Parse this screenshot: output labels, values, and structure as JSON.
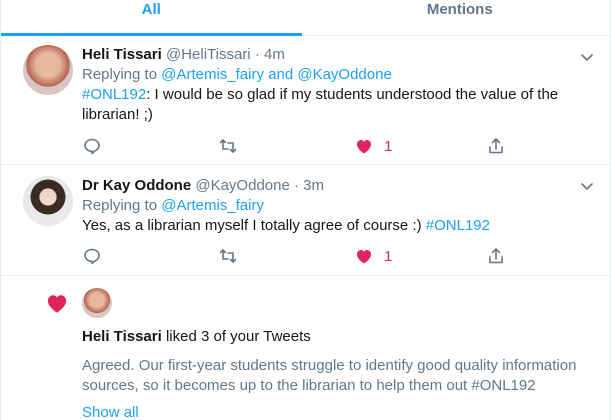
{
  "tabs": [
    {
      "label": "All",
      "active": true
    },
    {
      "label": "Mentions",
      "active": false
    }
  ],
  "tweets": [
    {
      "name": "Heli Tissari",
      "handle": "@HeliTissari",
      "time": "· 4m",
      "replying_prefix": "Replying to ",
      "reply_user_1": "@Artemis_fairy",
      "reply_and": " and ",
      "reply_user_2": "@KayOddone",
      "hashtag": "#ONL192",
      "text": ": I would be so glad if my students understood the value of the librarian! ;)",
      "likes": "1"
    },
    {
      "name": "Dr Kay Oddone",
      "handle": "@KayOddone",
      "time": "· 3m",
      "replying_prefix": "Replying to ",
      "reply_user_1": "@Artemis_fairy",
      "text": "Yes, as a librarian myself I totally agree of course :) ",
      "hashtag": "#ONL192",
      "likes": "1"
    }
  ],
  "notification": {
    "name": "Heli Tissari",
    "action": " liked 3 of your Tweets",
    "quote": "Agreed. Our first-year students struggle to identify good quality information sources, so it becomes up to the librarian to help them out #ONL192",
    "show_all": "Show all"
  },
  "colors": {
    "accent": "#1da1f2",
    "like": "#e0245e",
    "muted": "#657786",
    "text": "#14171a"
  },
  "icons": [
    "reply-icon",
    "retweet-icon",
    "heart-icon",
    "share-icon",
    "chevron-down-icon"
  ]
}
